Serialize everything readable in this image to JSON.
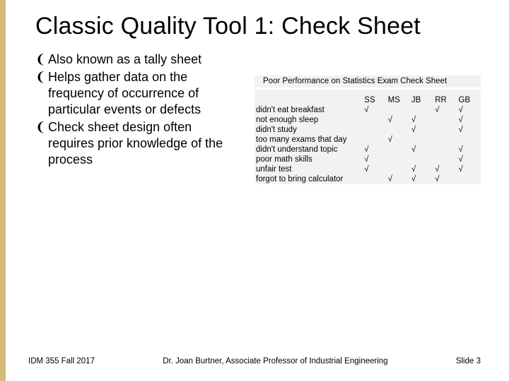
{
  "title": "Classic Quality Tool 1: Check Sheet",
  "bullet_mark": "༄",
  "bullets": [
    "Also known as a tally sheet",
    "Helps gather data on the frequency of occurrence of particular events or defects",
    "Check sheet design often requires prior knowledge of the process"
  ],
  "table": {
    "caption": "Poor Performance on Statistics Exam Check Sheet",
    "columns": [
      "SS",
      "MS",
      "JB",
      "RR",
      "GB"
    ],
    "check": "√",
    "rows": [
      {
        "reason": "didn't eat breakfast",
        "marks": [
          1,
          0,
          0,
          1,
          1
        ]
      },
      {
        "reason": "not enough sleep",
        "marks": [
          0,
          1,
          1,
          0,
          1
        ]
      },
      {
        "reason": "didn't study",
        "marks": [
          0,
          0,
          1,
          0,
          1
        ]
      },
      {
        "reason": "too many exams that day",
        "marks": [
          0,
          1,
          0,
          0,
          0
        ]
      },
      {
        "reason": "didn't understand topic",
        "marks": [
          1,
          0,
          1,
          0,
          1
        ]
      },
      {
        "reason": "poor math skills",
        "marks": [
          1,
          0,
          0,
          0,
          1
        ]
      },
      {
        "reason": "unfair test",
        "marks": [
          1,
          0,
          1,
          1,
          1
        ]
      },
      {
        "reason": "forgot to bring calculator",
        "marks": [
          0,
          1,
          1,
          1,
          0
        ]
      }
    ]
  },
  "footer": {
    "left": "IDM 355 Fall 2017",
    "center": "Dr. Joan Burtner, Associate Professor of Industrial Engineering",
    "right": "Slide 3"
  }
}
